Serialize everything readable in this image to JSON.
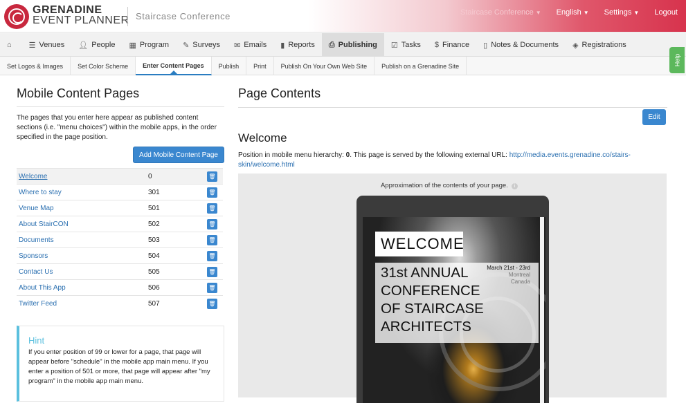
{
  "header": {
    "brand_line1": "GRENADINE",
    "brand_line2": "EVENT PLANNER",
    "conference_title": "Staircase Conference",
    "nav": {
      "conference": "Staircase Conference",
      "language": "English",
      "settings": "Settings",
      "logout": "Logout"
    }
  },
  "main_nav": [
    {
      "label": "",
      "icon": "home-icon"
    },
    {
      "label": "Venues",
      "icon": "list-icon"
    },
    {
      "label": "People",
      "icon": "person-icon"
    },
    {
      "label": "Program",
      "icon": "calendar-icon"
    },
    {
      "label": "Surveys",
      "icon": "pencil-icon"
    },
    {
      "label": "Emails",
      "icon": "envelope-icon"
    },
    {
      "label": "Reports",
      "icon": "bar-chart-icon"
    },
    {
      "label": "Publishing",
      "icon": "print-icon",
      "active": true
    },
    {
      "label": "Tasks",
      "icon": "check-icon"
    },
    {
      "label": "Finance",
      "icon": "dollar-icon"
    },
    {
      "label": "Notes & Documents",
      "icon": "document-icon"
    },
    {
      "label": "Registrations",
      "icon": "tag-icon"
    }
  ],
  "sub_nav": [
    {
      "label": "Set Logos & Images"
    },
    {
      "label": "Set Color Scheme"
    },
    {
      "label": "Enter Content Pages",
      "active": true
    },
    {
      "label": "Publish"
    },
    {
      "label": "Print"
    },
    {
      "label": "Publish On Your Own Web Site"
    },
    {
      "label": "Publish on a Grenadine Site"
    }
  ],
  "help_label": "Help",
  "left": {
    "title": "Mobile Content Pages",
    "description": "The pages that you enter here appear as published content sections (i.e. \"menu choices\") within the mobile apps, in the order specified in the page position.",
    "add_button": "Add Mobile Content Page",
    "pages": [
      {
        "name": "Welcome",
        "position": "0"
      },
      {
        "name": "Where to stay",
        "position": "301"
      },
      {
        "name": "Venue Map",
        "position": "501"
      },
      {
        "name": "About StairCON",
        "position": "502"
      },
      {
        "name": "Documents",
        "position": "503"
      },
      {
        "name": "Sponsors",
        "position": "504"
      },
      {
        "name": "Contact Us",
        "position": "505"
      },
      {
        "name": "About This App",
        "position": "506"
      },
      {
        "name": "Twitter Feed",
        "position": "507"
      }
    ],
    "hint": {
      "title": "Hint",
      "text": "If you enter position of 99 or lower for a page, that page will appear before \"schedule\" in the mobile app main menu. If you enter a position of 501 or more, that page will appear after \"my program\" in the mobile app main menu."
    }
  },
  "right": {
    "title": "Page Contents",
    "edit_button": "Edit",
    "page_title": "Welcome",
    "position_prefix": "Position in mobile menu hierarchy: ",
    "position_value": "0",
    "position_suffix": ". This page is served by the following external URL: ",
    "url": "http://media.events.grenadine.co/stairs-skin/welcome.html",
    "preview_note": "Approximation of the contents of your page.",
    "preview": {
      "welcome": "WELCOME",
      "line1": "31st ANNUAL",
      "line2": "CONFERENCE",
      "line3": "OF STAIRCASE",
      "line4": "ARCHITECTS",
      "date": "March 21st - 23rd",
      "city": "Montreal",
      "country": "Canada"
    }
  },
  "colors": {
    "primary": "#3a87cf",
    "brand_red": "#c8283e",
    "hint_accent": "#5bc0de",
    "help_green": "#5cb85c"
  }
}
